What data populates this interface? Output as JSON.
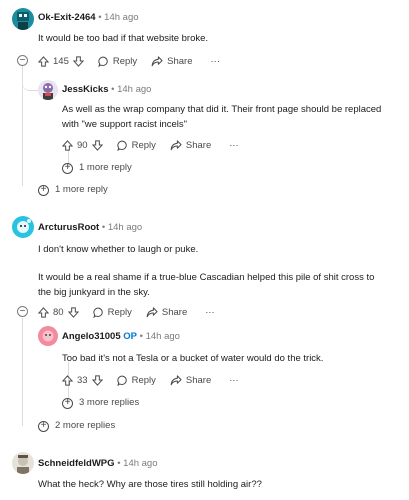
{
  "comments": [
    {
      "author": "Ok-Exit-2464",
      "time": "14h ago",
      "body": [
        "It would be too bad if that website broke."
      ],
      "votes": "145",
      "reply_label": "Reply",
      "share_label": "Share",
      "more_label": "···",
      "avatar_color": "#1a8e9e"
    },
    {
      "author": "JessKicks",
      "time": "14h ago",
      "body": [
        "As well as the wrap company that did it. Their front page should be replaced",
        "with \"we support racist incels\""
      ],
      "votes": "90",
      "reply_label": "Reply",
      "share_label": "Share",
      "more_label": "···",
      "more_replies": "1 more reply",
      "avatar_color": "#8a6aa8"
    },
    {
      "more_replies": "1 more reply"
    },
    {
      "author": "ArcturusRoot",
      "time": "14h ago",
      "body": [
        "I don't know whether to laugh or puke.",
        "It would be a real shame if a true-blue Cascadian helped this pile of shit cross to",
        "the big junkyard in the sky."
      ],
      "votes": "80",
      "reply_label": "Reply",
      "share_label": "Share",
      "more_label": "···",
      "avatar_color": "#27c3e0"
    },
    {
      "author": "Angelo31005",
      "op_badge": "OP",
      "time": "14h ago",
      "body": [
        "Too bad it's not a Tesla or a bucket of water would do the trick."
      ],
      "votes": "33",
      "reply_label": "Reply",
      "share_label": "Share",
      "more_label": "···",
      "more_replies": "3 more replies",
      "avatar_color": "#f28aa0"
    },
    {
      "more_replies": "2 more replies"
    },
    {
      "author": "SchneidfeldWPG",
      "time": "14h ago",
      "body": [
        "What the heck? Why are those tires still holding air??"
      ],
      "avatar_color": "#c9c2b4"
    }
  ],
  "separator": "•",
  "icons": {
    "upvote": "upvote-icon",
    "downvote": "downvote-icon",
    "reply": "reply-icon",
    "share": "share-icon",
    "collapse": "collapse-icon",
    "expand": "expand-icon"
  }
}
